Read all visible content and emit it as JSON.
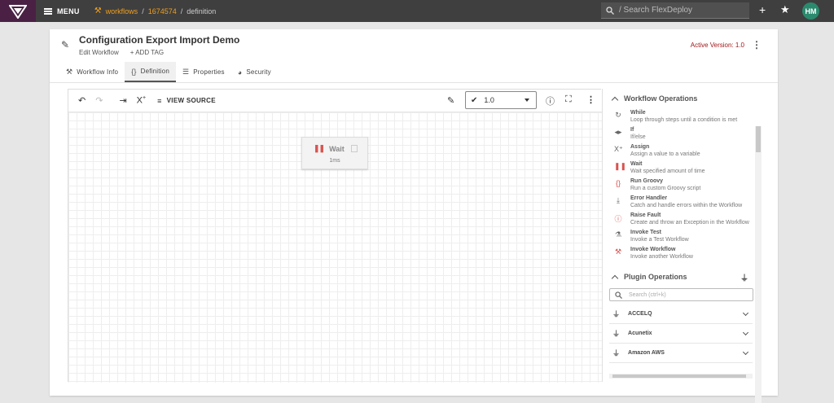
{
  "topbar": {
    "menu_label": "MENU",
    "breadcrumbs": [
      "workflows",
      "1674574",
      "definition"
    ],
    "search_placeholder": "/ Search FlexDeploy",
    "avatar_initials": "HM"
  },
  "workflow": {
    "title": "Configuration Export Import Demo",
    "edit_label": "Edit Workflow",
    "add_tag_label": "+ ADD TAG",
    "active_version": "Active Version: 1.0"
  },
  "tabs": [
    {
      "label": "Workflow Info",
      "icon": "hammer-icon"
    },
    {
      "label": "Definition",
      "icon": "braces-icon",
      "active": true
    },
    {
      "label": "Properties",
      "icon": "list-icon"
    },
    {
      "label": "Security",
      "icon": "shield-icon"
    }
  ],
  "toolbar": {
    "view_source_label": "VIEW SOURCE",
    "version_value": "1.0"
  },
  "canvas": {
    "node_title": "Wait",
    "node_duration": "1ms"
  },
  "workflow_operations": {
    "title": "Workflow Operations",
    "items": [
      {
        "name": "While",
        "desc": "Loop through steps until a condition is met",
        "icon": "loop-icon"
      },
      {
        "name": "If",
        "desc": "If/else",
        "icon": "branch-icon"
      },
      {
        "name": "Assign",
        "desc": "Assign a value to a variable",
        "icon": "variable-icon"
      },
      {
        "name": "Wait",
        "desc": "Wait specified amount of time",
        "icon": "pause-icon"
      },
      {
        "name": "Run Groovy",
        "desc": "Run a custom Groovy script",
        "icon": "braces-icon"
      },
      {
        "name": "Error Handler",
        "desc": "Catch and handle errors within the Workflow",
        "icon": "download-icon"
      },
      {
        "name": "Raise Fault",
        "desc": "Create and throw an Exception in the Workflow",
        "icon": "alert-icon"
      },
      {
        "name": "Invoke Test",
        "desc": "Invoke a Test Workflow",
        "icon": "flask-icon"
      },
      {
        "name": "Invoke Workflow",
        "desc": "Invoke another Workflow",
        "icon": "tools-icon"
      }
    ]
  },
  "plugin_operations": {
    "title": "Plugin Operations",
    "search_placeholder": "Search (ctrl+k)",
    "plugins": [
      "ACCELQ",
      "Acunetix",
      "Amazon AWS"
    ]
  },
  "colors": {
    "topbar": "#3f3f3f",
    "logo_bg": "#4a2145",
    "breadcrumb_link": "#f0a01e",
    "active_version": "#a0181a",
    "avatar": "#2a8a6e"
  }
}
